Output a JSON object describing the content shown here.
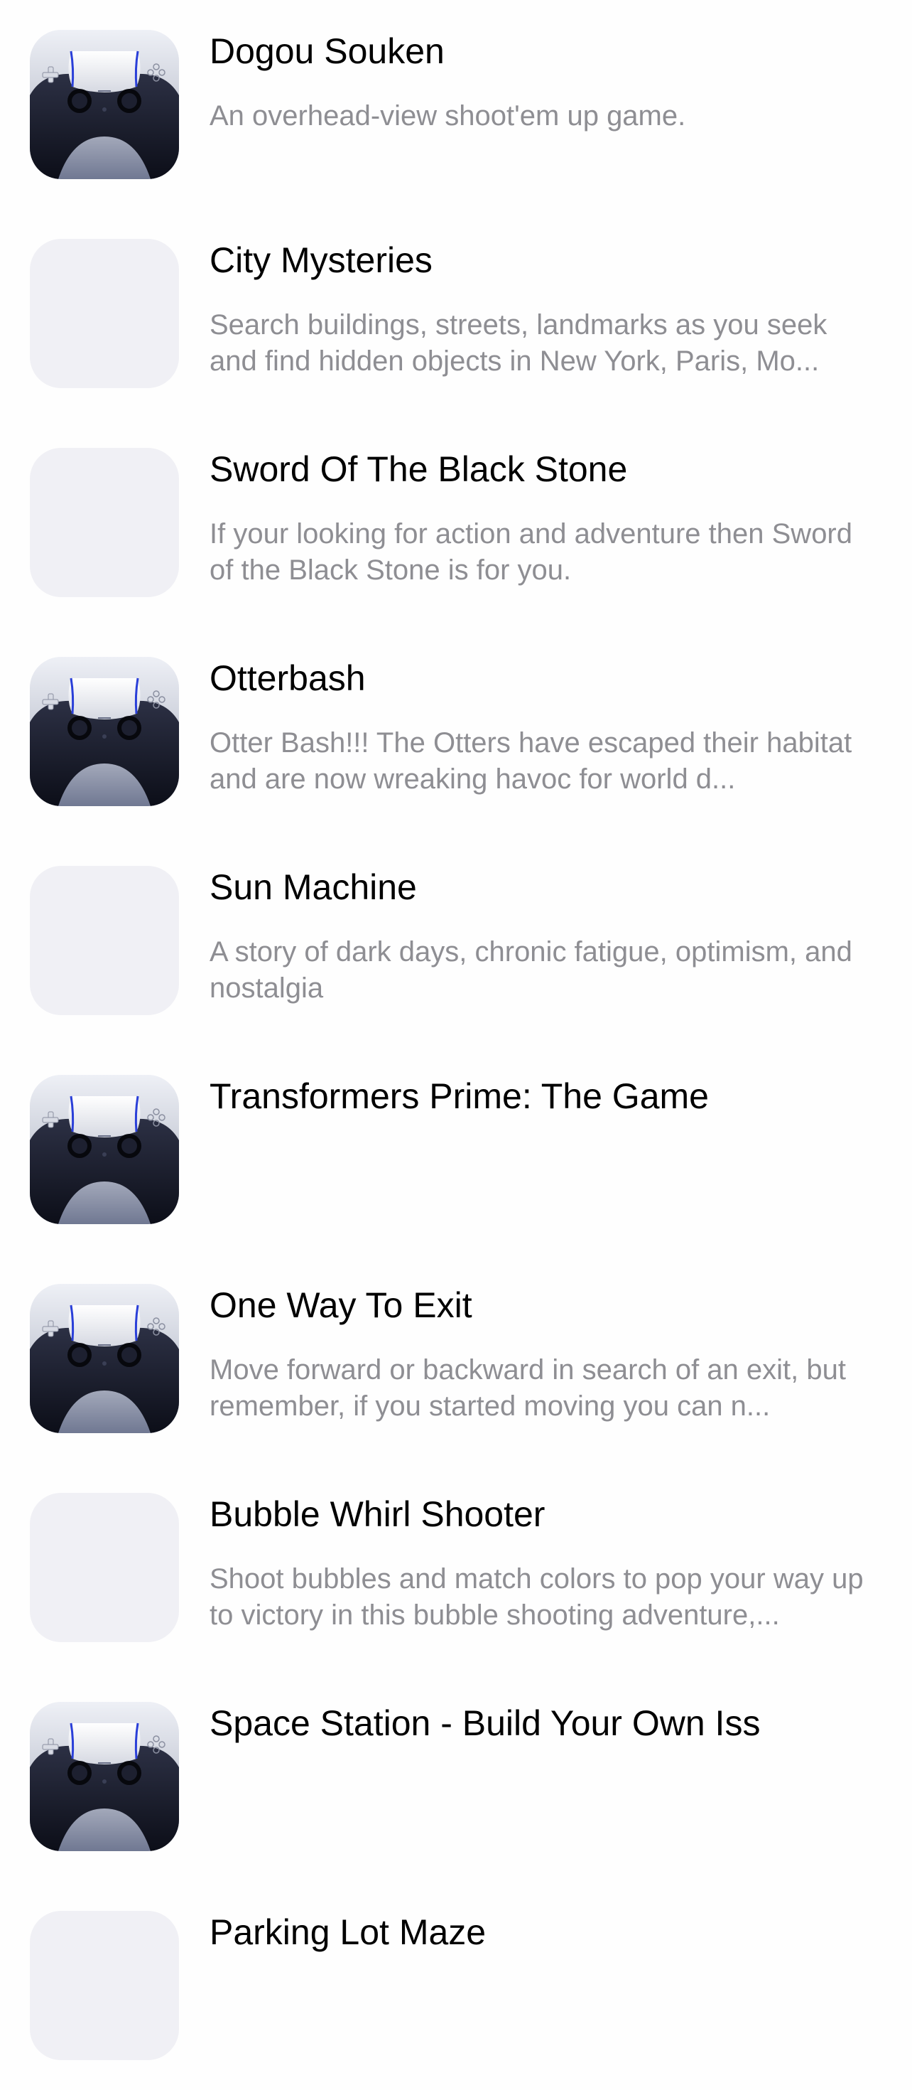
{
  "games": [
    {
      "title": "Dogou Souken",
      "description": "An overhead-view shoot'em up game.",
      "icon": "gamepad-icon"
    },
    {
      "title": "City Mysteries",
      "description": "Search buildings, streets, landmarks as you seek and find hidden objects in New York, Paris, Mo...",
      "icon": "placeholder-icon"
    },
    {
      "title": "Sword Of The Black Stone",
      "description": "If your looking for action and adventure then Sword of the Black Stone is for you.",
      "icon": "placeholder-icon"
    },
    {
      "title": "Otterbash",
      "description": "Otter Bash!!! The Otters have escaped their habitat and are now wreaking havoc for world d...",
      "icon": "gamepad-icon"
    },
    {
      "title": "Sun Machine",
      "description": "A story of dark days, chronic fatigue, optimism, and nostalgia",
      "icon": "placeholder-icon"
    },
    {
      "title": "Transformers Prime: The Game",
      "description": "",
      "icon": "gamepad-icon"
    },
    {
      "title": "One Way To Exit",
      "description": "Move forward or backward in search of an exit, but remember, if you started moving you can n...",
      "icon": "gamepad-icon"
    },
    {
      "title": "Bubble Whirl Shooter",
      "description": "Shoot bubbles and match colors to pop your way up to victory in this bubble shooting adventure,...",
      "icon": "placeholder-icon"
    },
    {
      "title": "Space Station - Build Your Own Iss",
      "description": "",
      "icon": "gamepad-icon"
    },
    {
      "title": "Parking Lot Maze",
      "description": "",
      "icon": "placeholder-icon"
    }
  ],
  "colors": {
    "background": "#fefefe",
    "title": "#000000",
    "description": "#8e8e93",
    "placeholder": "#f0f0f5",
    "controller_accent": "#2a3fd8"
  }
}
